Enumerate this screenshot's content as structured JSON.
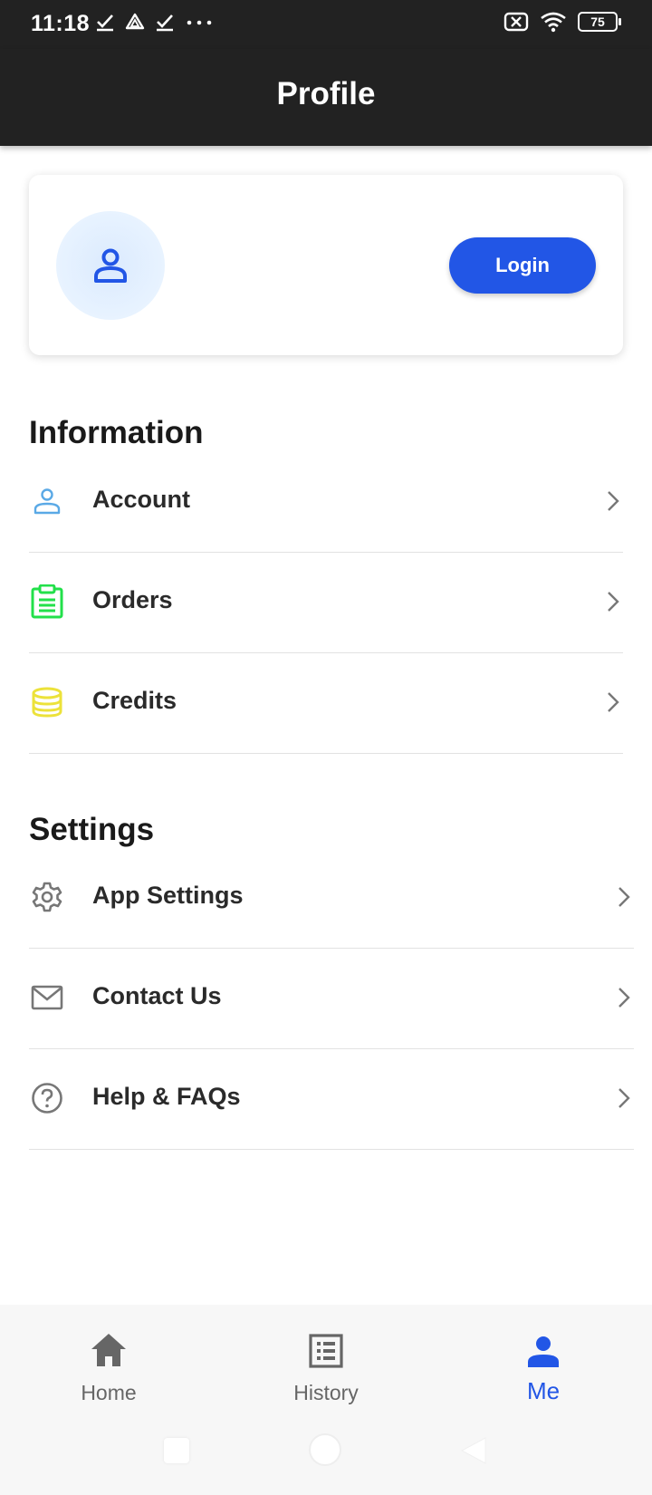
{
  "status_bar": {
    "time": "11:18",
    "battery": "75"
  },
  "header": {
    "title": "Profile"
  },
  "profile_card": {
    "login_label": "Login"
  },
  "sections": {
    "information": {
      "title": "Information",
      "items": [
        {
          "label": "Account",
          "icon": "person-outline-icon",
          "color": "#5aa9e6"
        },
        {
          "label": "Orders",
          "icon": "clipboard-list-icon",
          "color": "#22e04a"
        },
        {
          "label": "Credits",
          "icon": "coins-stack-icon",
          "color": "#ece23a"
        }
      ]
    },
    "settings": {
      "title": "Settings",
      "items": [
        {
          "label": "App Settings",
          "icon": "gear-icon",
          "color": "#777777"
        },
        {
          "label": "Contact Us",
          "icon": "envelope-icon",
          "color": "#777777"
        },
        {
          "label": "Help & FAQs",
          "icon": "question-circle-icon",
          "color": "#777777"
        }
      ]
    }
  },
  "bottom_nav": {
    "items": [
      {
        "label": "Home",
        "icon": "home-icon",
        "active": false
      },
      {
        "label": "History",
        "icon": "list-box-icon",
        "active": false
      },
      {
        "label": "Me",
        "icon": "person-icon",
        "active": true
      }
    ]
  },
  "colors": {
    "accent": "#2256e6",
    "header_bg": "#222222"
  }
}
